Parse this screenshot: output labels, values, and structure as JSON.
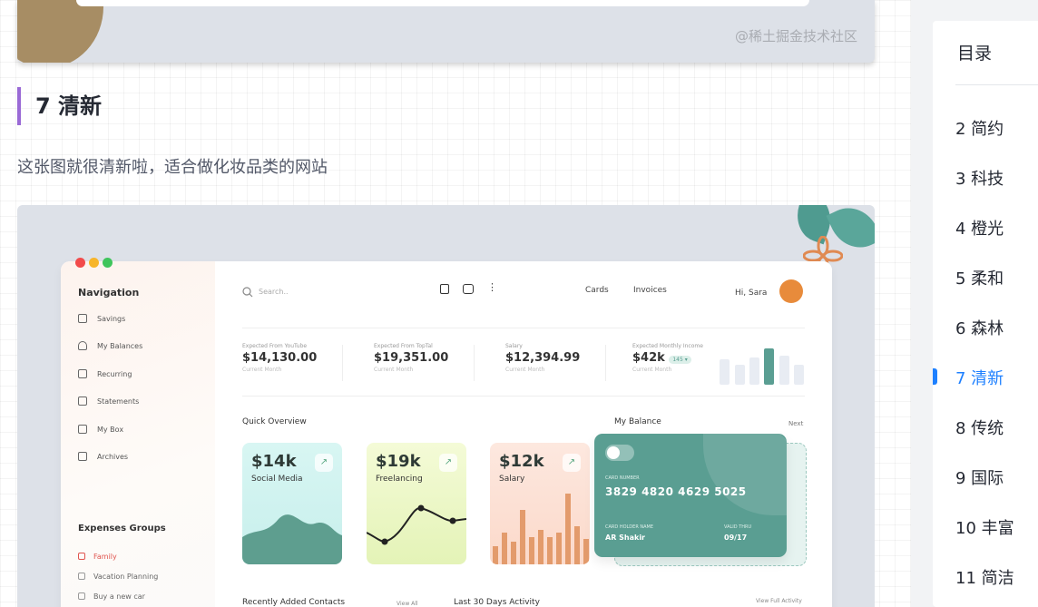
{
  "watermark": "@稀土掘金技术社区",
  "heading": "7 清新",
  "paragraph": "这张图就很清新啦，适合做化妆品类的网站",
  "dashboard": {
    "nav_title": "Navigation",
    "nav_items": [
      "Savings",
      "My Balances",
      "Recurring",
      "Statements",
      "My Box",
      "Archives"
    ],
    "search_placeholder": "Search..",
    "top_links": [
      "Cards",
      "Invoices"
    ],
    "greeting": "Hi, Sara",
    "stats": [
      {
        "label": "Expected From YouTube",
        "value": "$14,130.00",
        "sub": "Current Month"
      },
      {
        "label": "Expected From TopTal",
        "value": "$19,351.00",
        "sub": "Current Month"
      },
      {
        "label": "Salary",
        "value": "$12,394.99",
        "sub": "Current Month"
      },
      {
        "label": "Expected Monthly Income",
        "value": "$42k",
        "badge": "145 ▾",
        "sub": "Current Month"
      }
    ],
    "quick_overview": "Quick Overview",
    "cards": [
      {
        "value": "$14k",
        "name": "Social Media"
      },
      {
        "value": "$19k",
        "name": "Freelancing"
      },
      {
        "value": "$12k",
        "name": "Salary"
      }
    ],
    "balance_title": "My Balance",
    "balance_next": "Next",
    "card_number_label": "CARD NUMBER",
    "card_number": "3829 4820 4629 5025",
    "holder_label": "CARD HOLDER NAME",
    "holder": "AR Shakir",
    "valid_label": "VALID THRU",
    "valid": "09/17",
    "expenses_title": "Expenses  Groups",
    "groups": [
      "Family",
      "Vacation Planning",
      "Buy a new car"
    ],
    "recent_contacts": "Recently Added Contacts",
    "view_all": "View All",
    "last30": "Last 30 Days Activity",
    "view_full": "View Full Activity"
  },
  "toc": {
    "title": "目录",
    "items": [
      "2 简约",
      "3 科技",
      "4 橙光",
      "5 柔和",
      "6 森林",
      "7 清新",
      "8 传统",
      "9 国际",
      "10 丰富",
      "11 简洁"
    ],
    "active_index": 5
  },
  "colors": {
    "accent": "#1e80ff",
    "heading_bar": "#9a6ad6",
    "teal": "#5a9e92",
    "salary_bars": "#e39b6c"
  }
}
